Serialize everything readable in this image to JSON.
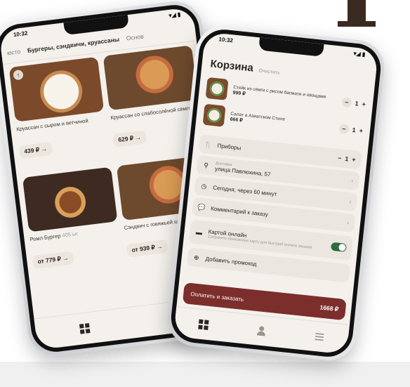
{
  "left_phone": {
    "status_time": "10:32",
    "tabs": [
      "Бургеры, сэндвичи, круассаны",
      "Основ"
    ],
    "tab_left_partial": "юсто",
    "cards": [
      {
        "title": "Круассан с сыром и ветчиной",
        "price": "439 ₽"
      },
      {
        "title": "Круассан со слабосолёной сёмгой",
        "price": "629 ₽"
      },
      {
        "title": "Ромл Бургер",
        "weight": "405 ыг",
        "price": "от 779 ₽"
      },
      {
        "title": "Сэндвич с говяжьей щё роно",
        "price": "от 939 ₽"
      }
    ]
  },
  "right_phone": {
    "status_time": "10:32",
    "cart_title": "Корзина",
    "clear_label": "Очистить",
    "items": [
      {
        "title": "Стейк из сёмги с рисом басмати и овощами",
        "price": "999 ₽",
        "qty": "1"
      },
      {
        "title": "Салат а Азиатском Стиле",
        "price": "666 ₽",
        "qty": "1"
      }
    ],
    "cutlery": {
      "label": "Приборы",
      "qty": "1"
    },
    "address": {
      "caption": "Доставка",
      "value": "улица Павлюхина, 57"
    },
    "time": "Сегодня, через 60 минут",
    "comment": "Комментарий к заказу",
    "payment": {
      "label": "Картой онлайн",
      "note": "Сохранить банковскую карту для быстрой оплаты заказов"
    },
    "promo": "Добавить промокод",
    "pay_label": "Оплатить и заказать",
    "total": "1668 ₽"
  },
  "colors": {
    "accent": "#7b2e2b",
    "toggle_on": "#2f6b3e",
    "screen_bg": "#f4f1ec"
  },
  "icons": [
    "grid-icon",
    "user-icon",
    "menu-icon",
    "fork-knife-icon",
    "location-icon",
    "clock-icon",
    "comment-icon",
    "card-icon",
    "plus-circle-icon"
  ]
}
